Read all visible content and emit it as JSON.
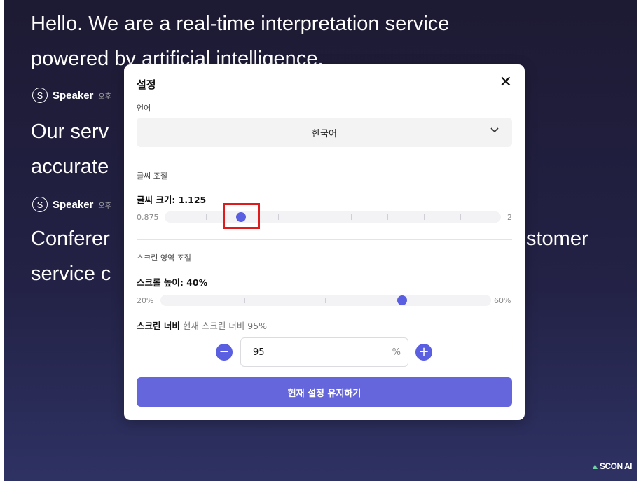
{
  "background": {
    "lines": [
      "Hello. We are a real-time interpretation service",
      "powered by artificial intelligence.",
      "Our serv",
      "accurate",
      "Conferer",
      "stomer",
      "service c"
    ],
    "speaker1": {
      "avatar": "S",
      "name": "Speaker",
      "time": "오후"
    },
    "speaker2": {
      "avatar": "S",
      "name": "Speaker",
      "time": "오후"
    },
    "logo": "SCON AI"
  },
  "modal": {
    "title": "설정",
    "close": "✕",
    "language_label": "언어",
    "language_value": "한국어",
    "font_section": "글씨 조절",
    "font_size_label": "글씨 크기: 1.125",
    "font_min": "0.875",
    "font_max": "2",
    "font_value": 1.125,
    "screen_section": "스크린 영역 조절",
    "scroll_height_label": "스크롤 높이: 40%",
    "scroll_min": "20%",
    "scroll_max": "60%",
    "scroll_value_percent": 40,
    "screen_width_label": "스크린 너비",
    "screen_width_current": "현재 스크린 너비 95%",
    "width_value": "95",
    "width_unit": "%",
    "minus": "−",
    "plus": "+",
    "keep_button": "현재 설정 유지하기"
  },
  "colors": {
    "accent": "#5a5ee0",
    "button": "#6566dc",
    "background_top": "#1d1a33"
  }
}
